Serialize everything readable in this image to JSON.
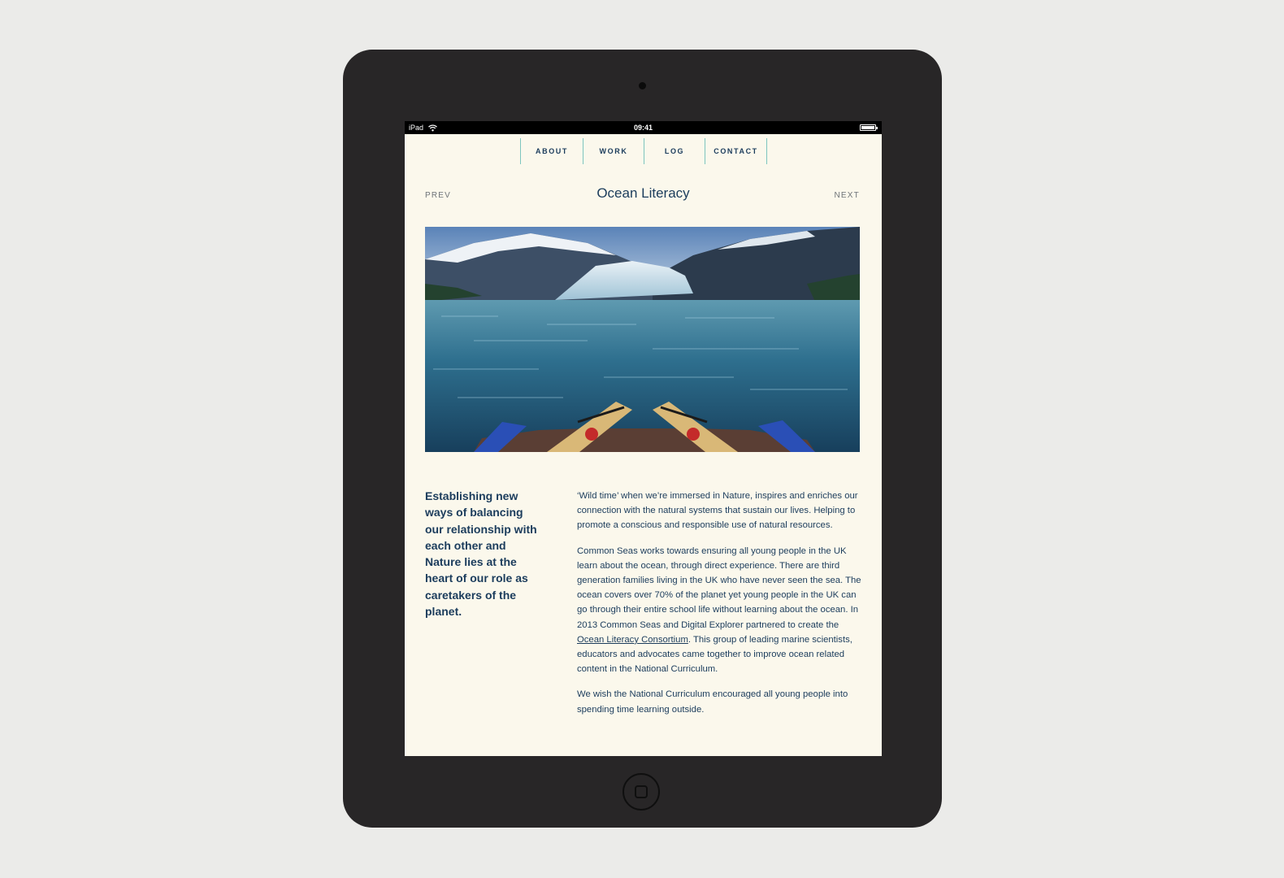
{
  "status_bar": {
    "device": "iPad",
    "time": "09:41"
  },
  "nav": {
    "items": [
      {
        "label": "ABOUT"
      },
      {
        "label": "WORK"
      },
      {
        "label": "LOG"
      },
      {
        "label": "CONTACT"
      }
    ]
  },
  "pager": {
    "prev": "PREV",
    "next": "NEXT"
  },
  "page": {
    "title": "Ocean Literacy",
    "intro": "Establishing new ways of balancing our relationship with each other and Nature lies at the heart of our role as caretakers of the planet.",
    "paragraph1": "‘Wild time’ when we’re immersed in Nature, inspires and enriches our connection with the natural systems that sustain our lives. Helping to promote a conscious and responsible use of natural resources.",
    "paragraph2_before": "Common Seas works towards ensuring all young people in the UK learn about the ocean, through direct experience. There are third generation families living in the UK who have never seen the sea. The ocean covers over 70% of the planet yet young people in the UK can go through their entire school life without learning about the ocean. In 2013 Common Seas and Digital Explorer partnered to create the ",
    "paragraph2_link": "Ocean Literacy Consortium",
    "paragraph2_after": ". This group of leading marine scientists, educators and advocates came together to improve ocean related content in the National Curriculum.",
    "paragraph3": "We wish the National Curriculum encouraged all young people into spending time learning outside."
  },
  "colors": {
    "page_background": "#ebebe9",
    "device_body": "#282627",
    "screen_background": "#fbf8ec",
    "text_navy": "#1b3c5c",
    "nav_divider": "#7dc6bf",
    "muted_text": "#6f7478"
  },
  "icons": {
    "wifi": "wifi-icon",
    "battery": "battery-icon",
    "camera": "camera-dot",
    "home": "home-button-icon"
  }
}
